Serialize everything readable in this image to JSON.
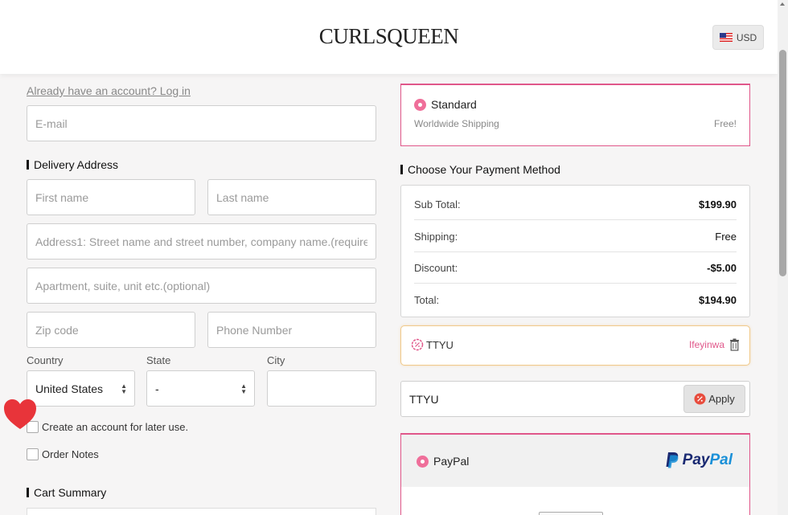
{
  "header": {
    "logo": "CURLSQUEEN",
    "currency": "USD"
  },
  "left": {
    "login_link": "Already have an account? Log in",
    "email_placeholder": "E-mail",
    "delivery_title": "Delivery Address",
    "first_name_placeholder": "First name",
    "last_name_placeholder": "Last name",
    "address1_placeholder": "Address1: Street name and street number, company name.(required)",
    "address2_placeholder": "Apartment, suite, unit etc.(optional)",
    "zip_placeholder": "Zip code",
    "phone_placeholder": "Phone Number",
    "country_label": "Country",
    "state_label": "State",
    "city_label": "City",
    "country_value": "United States",
    "state_value": "-",
    "create_account_label": "Create an account for later use.",
    "order_notes_label": "Order Notes",
    "cart_title": "Cart Summary"
  },
  "shipping": {
    "method": "Standard",
    "description": "Worldwide Shipping",
    "price": "Free!"
  },
  "payment": {
    "title": "Choose Your Payment Method",
    "subtotal_label": "Sub Total:",
    "subtotal_value": "$199.90",
    "shipping_label": "Shipping:",
    "shipping_value": "Free",
    "discount_label": "Discount:",
    "discount_value": "-$5.00",
    "total_label": "Total:",
    "total_value": "$194.90"
  },
  "coupon": {
    "code": "TTYU",
    "user": "Ifeyinwa"
  },
  "promo": {
    "input_value": "TTYU",
    "apply_label": "Apply"
  },
  "paypal": {
    "option_label": "PayPal",
    "logo_text_1": "Pay",
    "logo_text_2": "Pal"
  },
  "colors": {
    "accent_pink": "#e0578a",
    "coupon_border": "#f0c98a",
    "paypal_dark": "#1a2a72",
    "paypal_light": "#1a90d8"
  },
  "icons": [
    "us-flag-icon",
    "heart-icon",
    "coupon-badge-icon",
    "trash-icon",
    "paypal-logo-icon"
  ]
}
